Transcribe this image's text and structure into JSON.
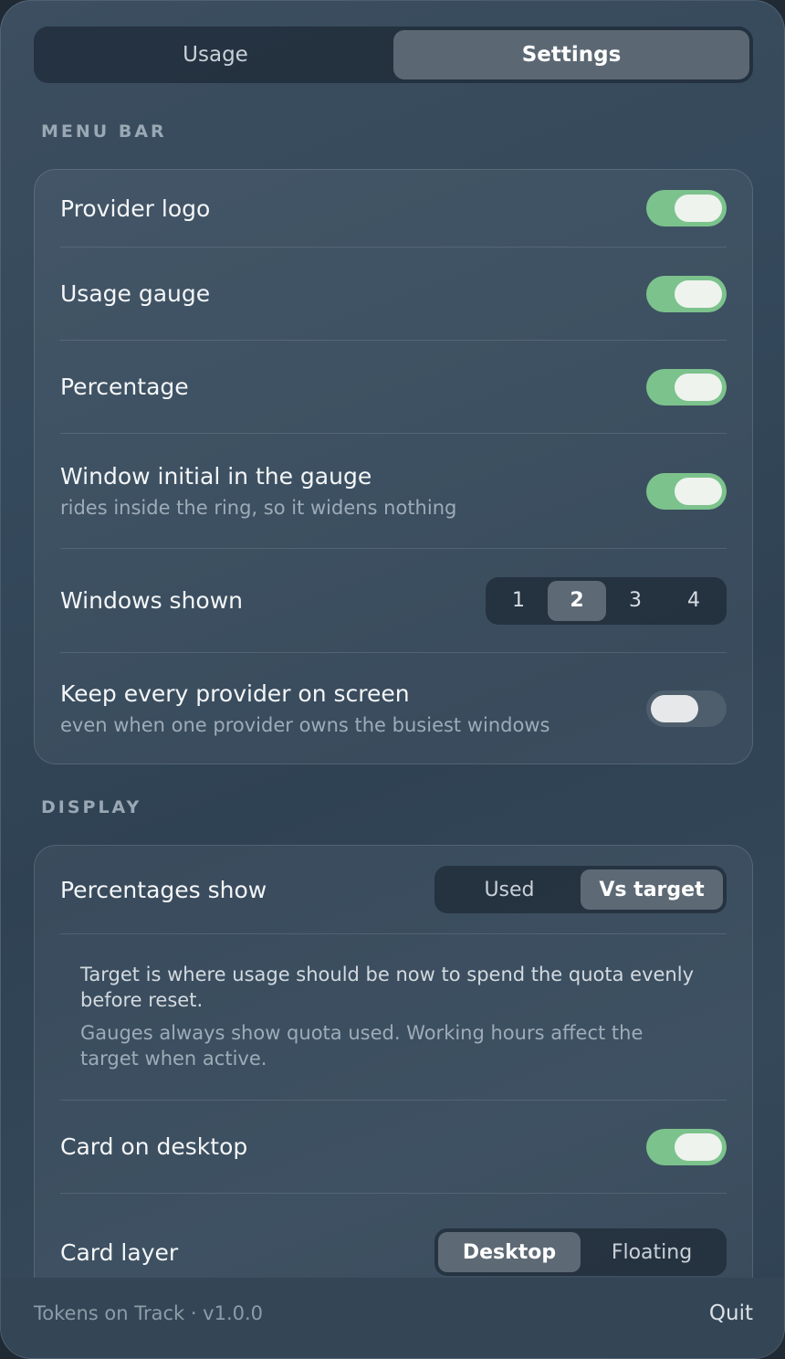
{
  "tabs": [
    {
      "label": "Usage",
      "active": false
    },
    {
      "label": "Settings",
      "active": true
    }
  ],
  "menu_bar": {
    "section_label": "MENU BAR",
    "provider_logo": {
      "label": "Provider logo",
      "on": true
    },
    "usage_gauge": {
      "label": "Usage gauge",
      "on": true
    },
    "percentage": {
      "label": "Percentage",
      "on": true
    },
    "window_initial": {
      "label": "Window initial in the gauge",
      "sub": "rides inside the ring, so it widens nothing",
      "on": true
    },
    "windows_shown": {
      "label": "Windows shown",
      "options": [
        "1",
        "2",
        "3",
        "4"
      ],
      "selected": "2"
    },
    "keep_every_provider": {
      "label": "Keep every provider on screen",
      "sub": "even when one provider owns the busiest windows",
      "on": false
    }
  },
  "display": {
    "section_label": "DISPLAY",
    "percentages_show": {
      "label": "Percentages show",
      "options": [
        "Used",
        "Vs target"
      ],
      "selected": "Vs target"
    },
    "info_primary": "Target is where usage should be now to spend the quota evenly before reset.",
    "info_secondary": "Gauges always show quota used. Working hours affect the target when active.",
    "card_on_desktop": {
      "label": "Card on desktop",
      "on": true
    },
    "card_layer": {
      "label": "Card layer",
      "options": [
        "Desktop",
        "Floating"
      ],
      "selected": "Desktop"
    }
  },
  "footer": {
    "version_text": "Tokens on Track · v1.0.0",
    "quit_label": "Quit"
  },
  "colors": {
    "toggle_on": "#7cc28c",
    "segment_active": "#5d6a75"
  }
}
